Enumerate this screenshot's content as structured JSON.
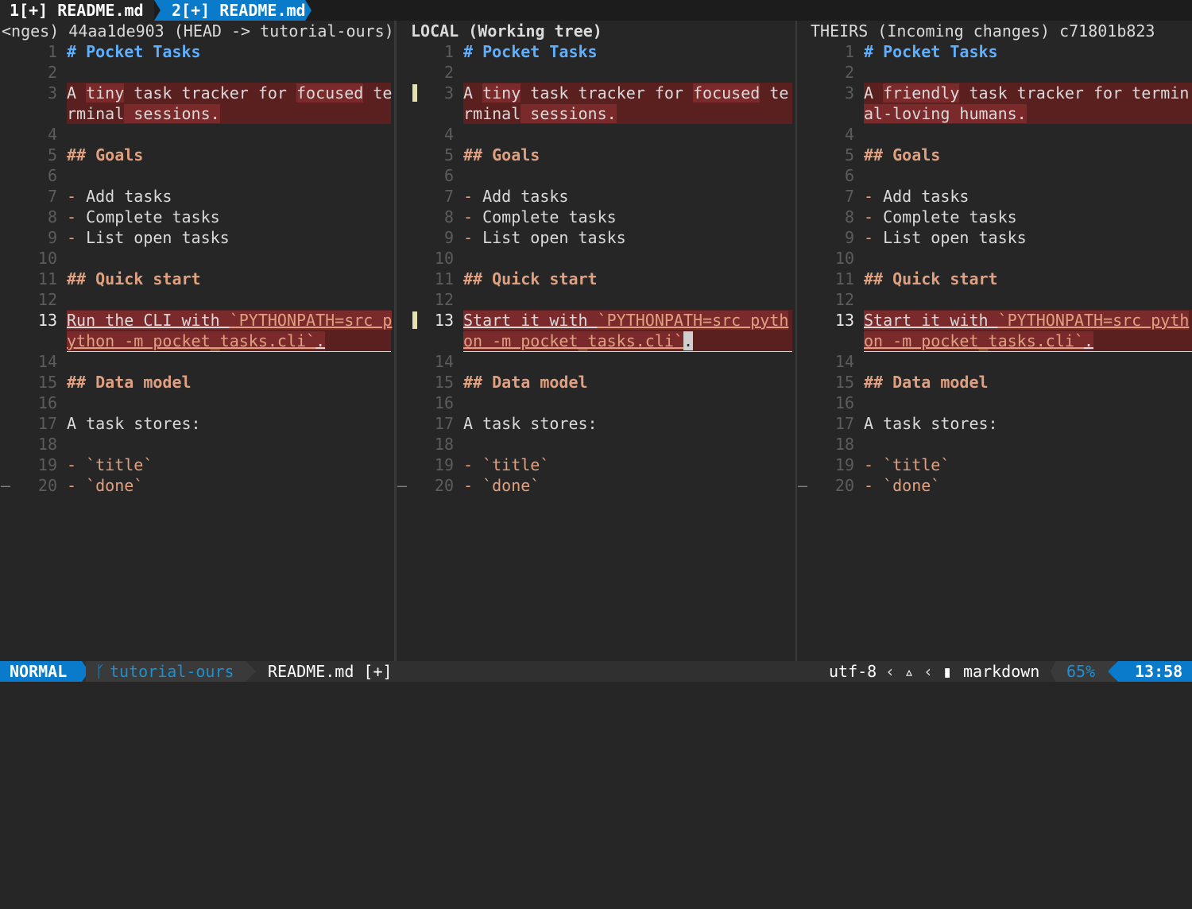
{
  "tabs": [
    {
      "label": "1[+] README.md"
    },
    {
      "label": "2[+] README.md"
    }
  ],
  "panes": {
    "base": {
      "header": "<nges) 44aa1de903 (HEAD -> tutorial-ours)"
    },
    "local": {
      "header": "LOCAL (Working tree)"
    },
    "theirs": {
      "header": "THEIRS (Incoming changes) c71801b823"
    }
  },
  "content": {
    "l1": "# Pocket Tasks",
    "l5": "## Goals",
    "l7": "Add tasks",
    "l8": "Complete tasks",
    "l9": "List open tasks",
    "l11": "## Quick start",
    "l15": "## Data model",
    "l17": "A task stores:",
    "l19": "`title`",
    "l20": "`done`",
    "dash": "-",
    "base_l3a": "A ",
    "base_l3b": "tiny",
    "base_l3c": " task tracker for ",
    "base_l3d": "focused",
    "base_l3e": " te",
    "base_l3f": "rminal",
    "base_l3g": " sessions.",
    "base_l13a": "Run the CLI with ",
    "base_l13b": "`PYTHONPATH=src p",
    "base_l13c": "ython -m pocket_tasks.cli`",
    "base_l13d": ".",
    "local_l13a": "Start it with ",
    "local_l13b": "`PYTHONPATH=src pyth",
    "local_l13c": "on -m pocket_tasks.cli`",
    "local_l13d": ".",
    "theirs_l3a": "A ",
    "theirs_l3b": "friendly",
    "theirs_l3c": " task tracker for termin",
    "theirs_l3d": "al-loving",
    "theirs_l3e": " humans.",
    "theirs_l13a": "Start it with ",
    "theirs_l13b": "`PYTHONPATH=src pyth",
    "theirs_l13c": "on -m pocket_tasks.cli`",
    "theirs_l13d": "."
  },
  "line_numbers": [
    "1",
    "2",
    "3",
    "",
    "4",
    "5",
    "6",
    "7",
    "8",
    "9",
    "10",
    "11",
    "12",
    "13",
    "",
    "14",
    "15",
    "16",
    "17",
    "18",
    "19",
    "20"
  ],
  "statusline": {
    "mode": "NORMAL",
    "branch": "tutorial-ours",
    "branch_icon": "git-branch-icon",
    "filename": "README.md [+]",
    "encoding": "utf-8",
    "os_icon": "linux-icon",
    "file_icon": "file-icon",
    "filetype": "markdown",
    "percent": "65%",
    "time": "13:58"
  },
  "colors": {
    "accent": "#0a7aca",
    "diff_bg": "#5a1f1f",
    "diff_text_bg": "#7a2a2a",
    "heading1": "#5fafff",
    "heading2": "#e0a080"
  }
}
